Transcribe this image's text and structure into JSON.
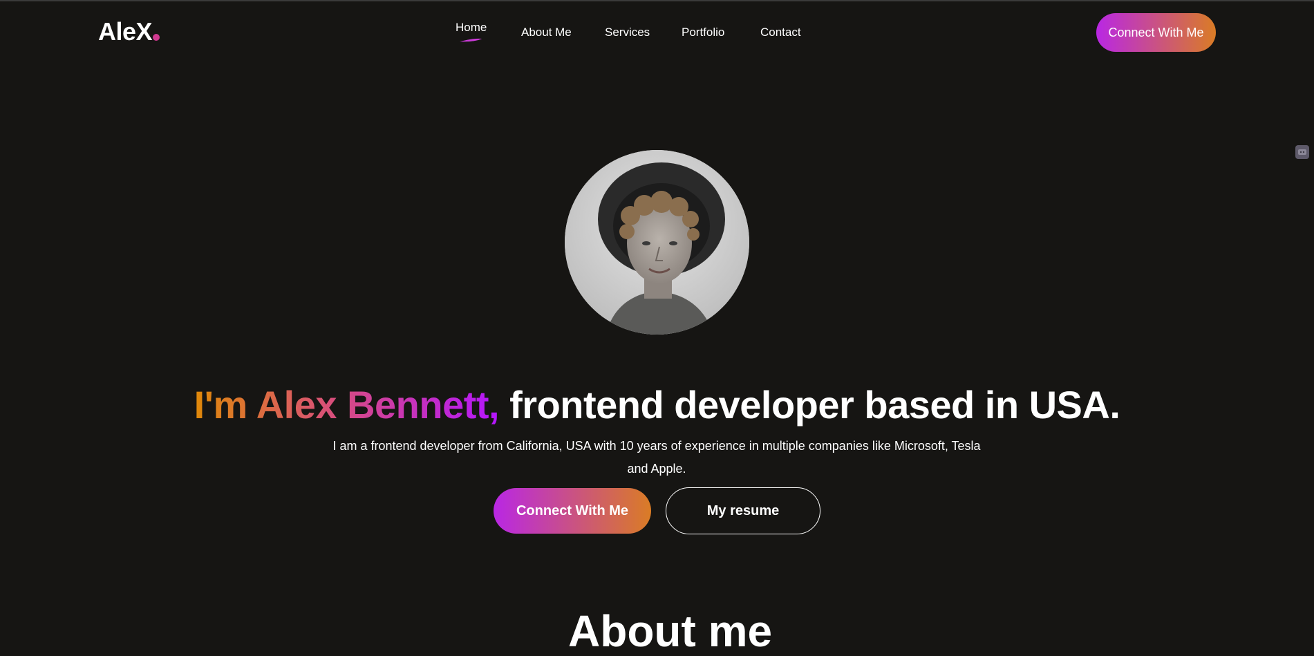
{
  "navbar": {
    "logo": "AleX",
    "menu": [
      {
        "label": "Home",
        "active": true
      },
      {
        "label": "About Me",
        "active": false
      },
      {
        "label": "Services",
        "active": false
      },
      {
        "label": "Portfolio",
        "active": false
      },
      {
        "label": "Contact",
        "active": false
      }
    ],
    "cta_label": "Connect With Me"
  },
  "hero": {
    "title_highlight": "I'm Alex Bennett,",
    "title_rest": " frontend developer based in USA.",
    "description": "I am a frontend developer from California, USA with 10 years of experience in multiple companies like Microsoft, Tesla and Apple.",
    "primary_button": "Connect With Me",
    "secondary_button": "My resume"
  },
  "next_section": {
    "heading_partial": "About me"
  },
  "colors": {
    "background": "#161513",
    "gradient_start": "#b927e4",
    "gradient_end": "#da7c25",
    "accent_pink": "#d0398f"
  }
}
